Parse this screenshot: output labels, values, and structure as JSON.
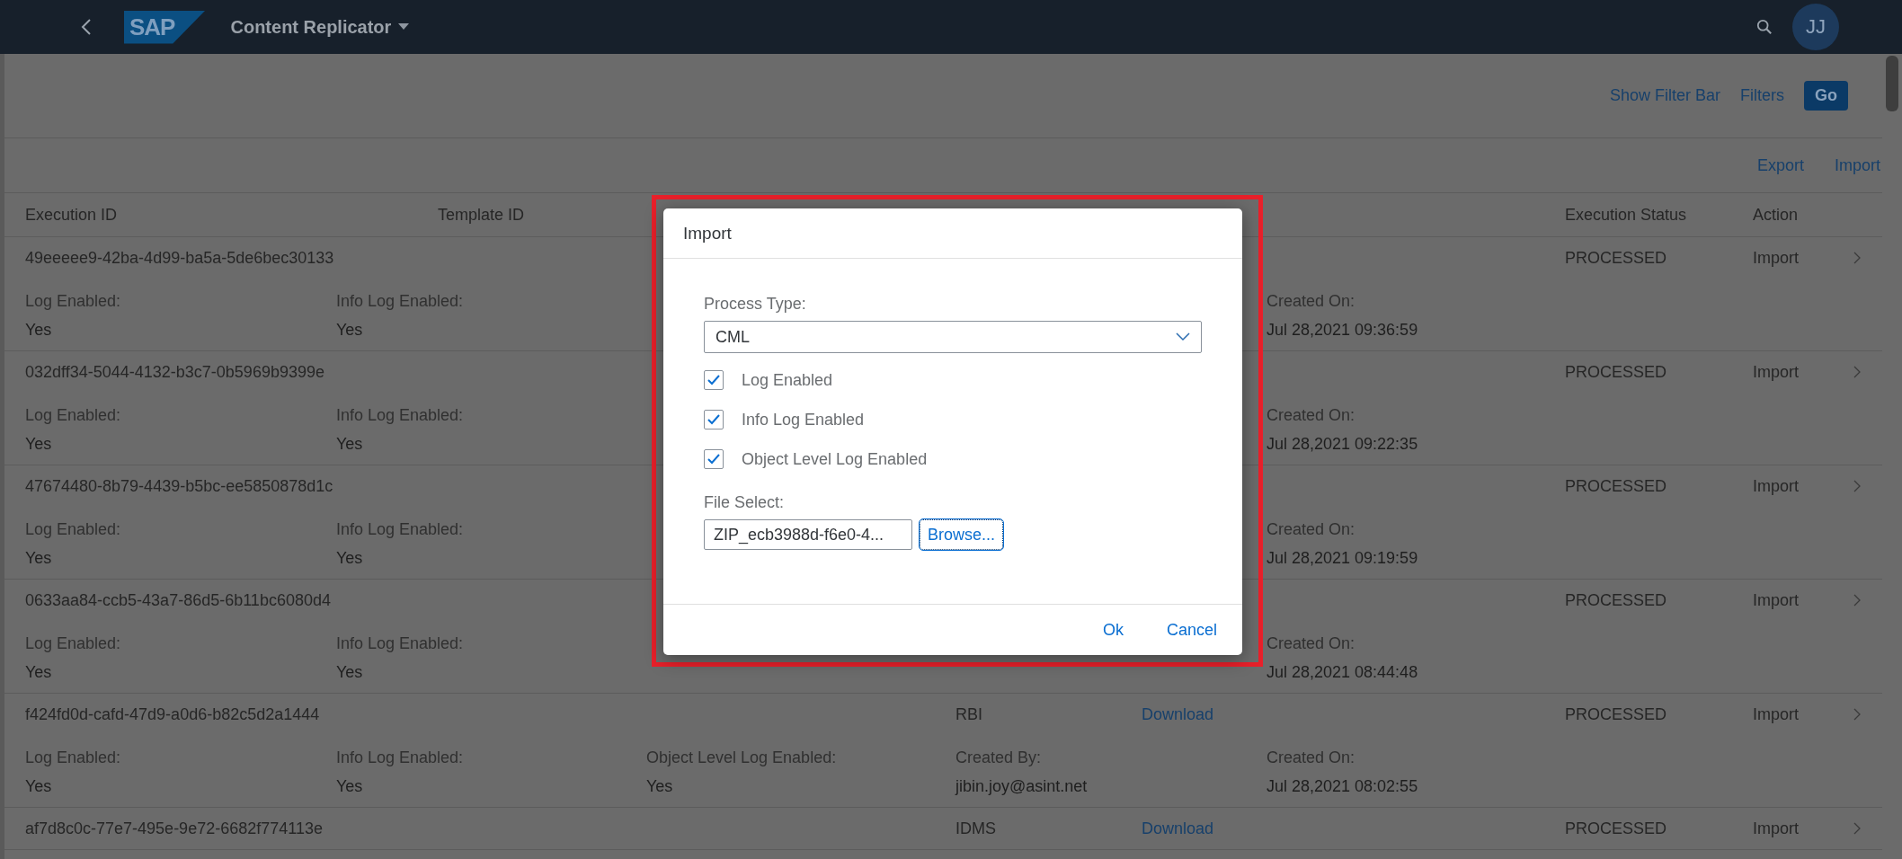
{
  "shell": {
    "logo": "SAP",
    "title": "Content Replicator",
    "avatar": "JJ"
  },
  "filter_bar": {
    "show_filter_bar": "Show Filter Bar",
    "filters": "Filters",
    "go": "Go"
  },
  "toolbar": [
    "Export",
    "Import"
  ],
  "columns": [
    {
      "kind": "id",
      "label": "Execution ID"
    },
    {
      "kind": "template",
      "label": "Template ID"
    },
    {
      "kind": "status",
      "label": "Execution Status"
    },
    {
      "kind": "action",
      "label": "Action"
    }
  ],
  "rows": [
    {
      "id": "49eeeee9-42ba-4d99-ba5a-5de6bec30133",
      "status": "PROCESSED",
      "action": "Import",
      "details": {
        "log_enabled": {
          "label": "Log Enabled:",
          "value": "Yes"
        },
        "info_log_enabled": {
          "label": "Info Log Enabled:",
          "value": "Yes"
        },
        "created_on": {
          "label": "Created On:",
          "value": "Jul 28,2021 09:36:59"
        }
      }
    },
    {
      "id": "032dff34-5044-4132-b3c7-0b5969b9399e",
      "status": "PROCESSED",
      "action": "Import",
      "details": {
        "log_enabled": {
          "label": "Log Enabled:",
          "value": "Yes"
        },
        "info_log_enabled": {
          "label": "Info Log Enabled:",
          "value": "Yes"
        },
        "created_on": {
          "label": "Created On:",
          "value": "Jul 28,2021 09:22:35"
        }
      }
    },
    {
      "id": "47674480-8b79-4439-b5bc-ee5850878d1c",
      "status": "PROCESSED",
      "action": "Import",
      "details": {
        "log_enabled": {
          "label": "Log Enabled:",
          "value": "Yes"
        },
        "info_log_enabled": {
          "label": "Info Log Enabled:",
          "value": "Yes"
        },
        "created_on": {
          "label": "Created On:",
          "value": "Jul 28,2021 09:19:59"
        }
      }
    },
    {
      "id": "0633aa84-ccb5-43a7-86d5-6b11bc6080d4",
      "status": "PROCESSED",
      "action": "Import",
      "details": {
        "log_enabled": {
          "label": "Log Enabled:",
          "value": "Yes"
        },
        "info_log_enabled": {
          "label": "Info Log Enabled:",
          "value": "Yes"
        },
        "created_on": {
          "label": "Created On:",
          "value": "Jul 28,2021 08:44:48"
        }
      }
    },
    {
      "id": "f424fd0d-cafd-47d9-a0d6-b82c5d2a1444",
      "process_type": "RBI",
      "download": "Download",
      "status": "PROCESSED",
      "action": "Import",
      "details": {
        "log_enabled": {
          "label": "Log Enabled:",
          "value": "Yes"
        },
        "info_log_enabled": {
          "label": "Info Log Enabled:",
          "value": "Yes"
        },
        "object_level_log_enabled": {
          "label": "Object Level Log Enabled:",
          "value": "Yes"
        },
        "created_by": {
          "label": "Created By:",
          "value": "jibin.joy@asint.net"
        },
        "created_on": {
          "label": "Created On:",
          "value": "Jul 28,2021 08:02:55"
        }
      }
    },
    {
      "id": "af7d8c0c-77e7-495e-9e72-6682f774113e",
      "process_type": "IDMS",
      "download": "Download",
      "status": "PROCESSED",
      "action": "Import"
    }
  ],
  "dialog": {
    "title": "Import",
    "process_type": {
      "label": "Process Type:",
      "value": "CML"
    },
    "options": [
      {
        "label": "Log Enabled",
        "checked": true
      },
      {
        "label": "Info Log Enabled",
        "checked": true
      },
      {
        "label": "Object Level Log Enabled",
        "checked": true
      }
    ],
    "file_select": {
      "label": "File Select:",
      "value": "ZIP_ecb3988d-f6e0-4..."
    },
    "browse": "Browse...",
    "buttons": [
      "Ok",
      "Cancel"
    ]
  }
}
